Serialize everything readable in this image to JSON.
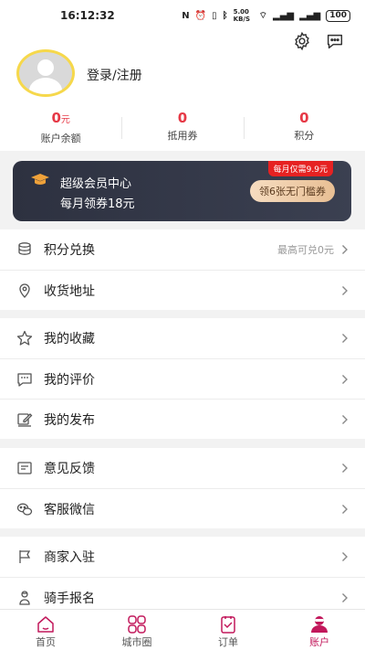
{
  "status_bar": {
    "time": "16:12:32",
    "network": "5.00 KB/S",
    "battery": "100"
  },
  "account": {
    "login_label": "登录/注册"
  },
  "stats": [
    {
      "value": "0",
      "unit": "元",
      "label": "账户余额"
    },
    {
      "value": "0",
      "unit": "",
      "label": "抵用券"
    },
    {
      "value": "0",
      "unit": "",
      "label": "积分"
    }
  ],
  "vip": {
    "title": "超级会员中心",
    "subtitle": "每月领券18元",
    "badge": "每月仅需9.9元",
    "button": "领6张无门槛券"
  },
  "menu_groups": [
    [
      {
        "label": "积分兑换",
        "hint": "最高可兑0元",
        "icon": "coins-icon"
      },
      {
        "label": "收货地址",
        "hint": "",
        "icon": "location-icon"
      }
    ],
    [
      {
        "label": "我的收藏",
        "hint": "",
        "icon": "star-icon"
      },
      {
        "label": "我的评价",
        "hint": "",
        "icon": "comment-icon"
      },
      {
        "label": "我的发布",
        "hint": "",
        "icon": "edit-icon"
      }
    ],
    [
      {
        "label": "意见反馈",
        "hint": "",
        "icon": "feedback-icon"
      },
      {
        "label": "客服微信",
        "hint": "",
        "icon": "wechat-icon"
      }
    ],
    [
      {
        "label": "商家入驻",
        "hint": "",
        "icon": "flag-icon"
      },
      {
        "label": "骑手报名",
        "hint": "",
        "icon": "rider-icon"
      }
    ]
  ],
  "tabbar": [
    {
      "label": "首页",
      "icon": "home-icon",
      "active": false
    },
    {
      "label": "城市圈",
      "icon": "grid-icon",
      "active": false
    },
    {
      "label": "订单",
      "icon": "order-icon",
      "active": false
    },
    {
      "label": "账户",
      "icon": "account-icon",
      "active": true
    }
  ],
  "colors": {
    "accent": "#e63946",
    "tab_active": "#c2185b",
    "vip_bg": "#2d3140",
    "avatar_ring": "#f6d84b"
  }
}
